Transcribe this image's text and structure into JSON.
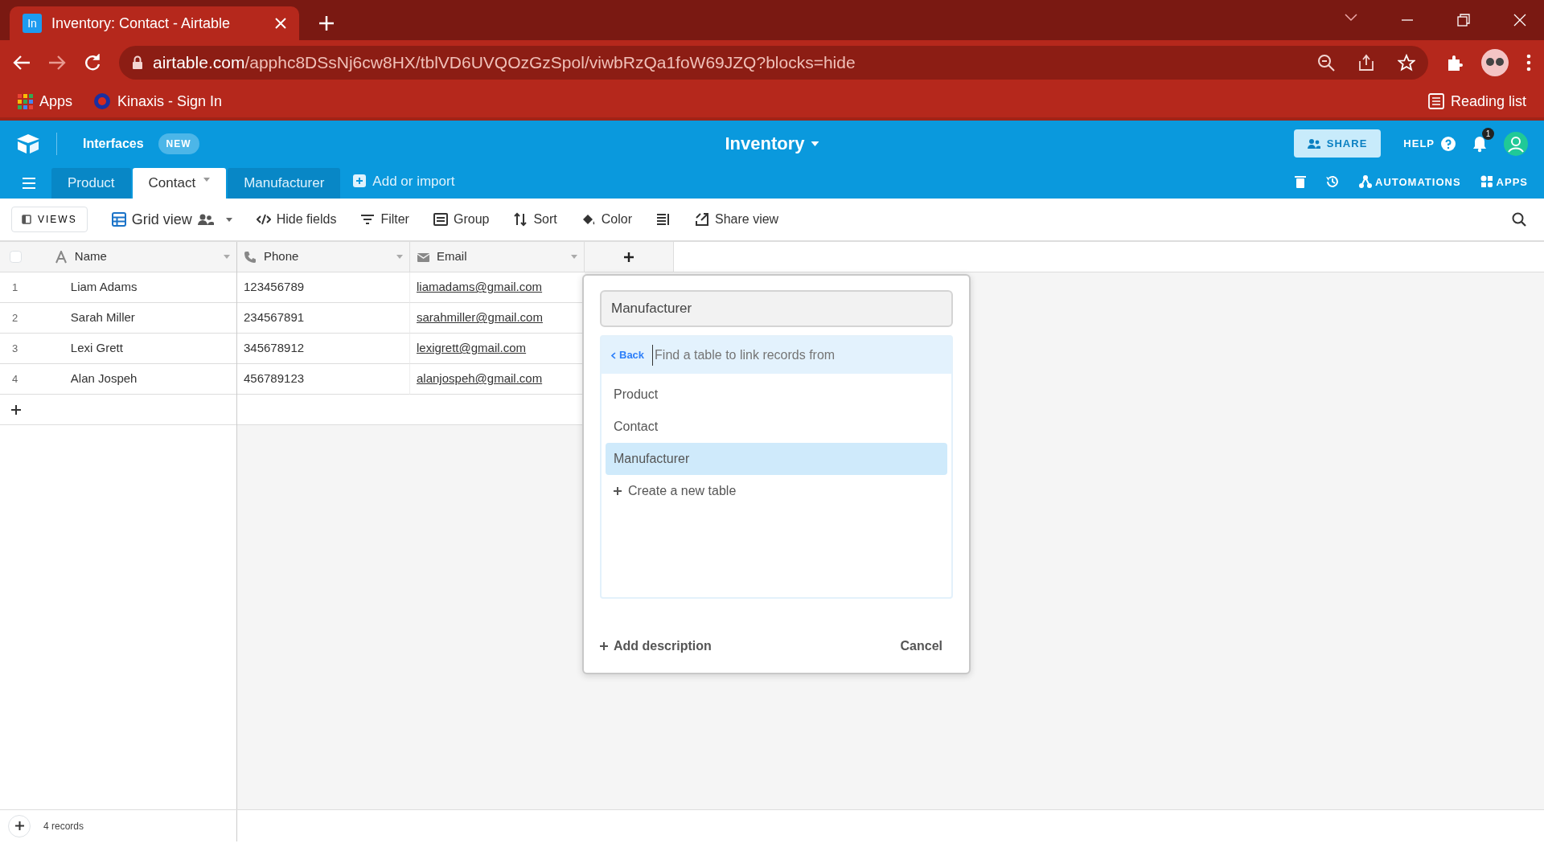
{
  "browser": {
    "tab_title": "Inventory: Contact - Airtable",
    "tab_icon": "In",
    "url_host": "airtable.com",
    "url_path": "/apphc8DSsNj6cw8HX/tblVD6UVQOzGzSpol/viwbRzQa1foW69JZQ?blocks=hide",
    "bookmarks": [
      "Apps",
      "Kinaxis - Sign In"
    ],
    "reading_list": "Reading list"
  },
  "app": {
    "interfaces": "Interfaces",
    "new_badge": "NEW",
    "base_name": "Inventory",
    "share": "SHARE",
    "help": "HELP",
    "notifications": "1"
  },
  "tables": [
    {
      "label": "Product",
      "selected": false
    },
    {
      "label": "Contact",
      "selected": true
    },
    {
      "label": "Manufacturer",
      "selected": false
    }
  ],
  "add_table": "Add or import",
  "right_tools": [
    "AUTOMATIONS",
    "APPS"
  ],
  "toolbar": {
    "views": "VIEWS",
    "view_name": "Grid view",
    "actions": [
      "Hide fields",
      "Filter",
      "Group",
      "Sort",
      "Color",
      "Share view"
    ]
  },
  "select_all_checked": false,
  "columns": [
    {
      "kind": "text",
      "label": "Name"
    },
    {
      "kind": "phone",
      "label": "Phone"
    },
    {
      "kind": "email",
      "label": "Email"
    }
  ],
  "rows": [
    {
      "number": "1",
      "cells": [
        "Liam Adams",
        "123456789",
        "liamadams@gmail.com"
      ]
    },
    {
      "number": "2",
      "cells": [
        "Sarah Miller",
        "234567891",
        "sarahmiller@gmail.com"
      ]
    },
    {
      "number": "3",
      "cells": [
        "Lexi Grett",
        "345678912",
        "lexigrett@gmail.com"
      ]
    },
    {
      "number": "4",
      "cells": [
        "Alan Jospeh",
        "456789123",
        "alanjospeh@gmail.com"
      ]
    }
  ],
  "record_count": "4 records",
  "popup": {
    "field_name": "Manufacturer",
    "back": "Back",
    "search_placeholder": "Find a table to link records from",
    "options": [
      {
        "label": "Product",
        "selected": false
      },
      {
        "label": "Contact",
        "selected": false
      },
      {
        "label": "Manufacturer",
        "selected": true
      }
    ],
    "create": "Create a new table",
    "add_description": "Add description",
    "cancel": "Cancel"
  }
}
